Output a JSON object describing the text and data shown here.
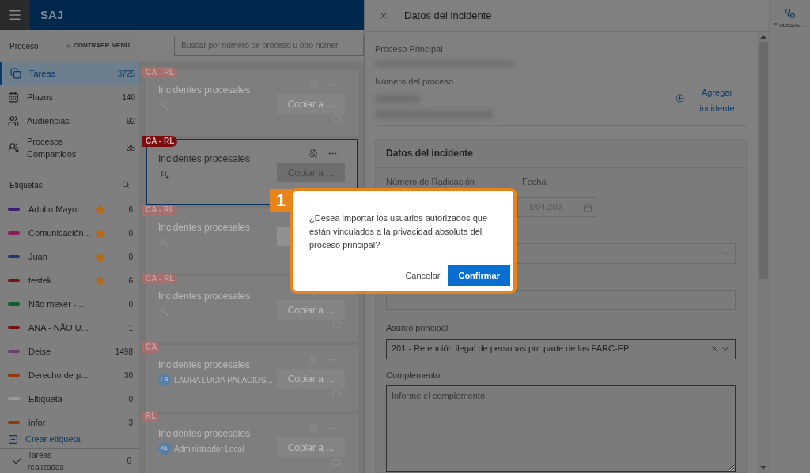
{
  "app": {
    "title": "SAJ"
  },
  "sidebar": {
    "heading": "Proceso",
    "collapse_label": "CONTRAER MENÚ",
    "nav": [
      {
        "kind": "tasks",
        "label": "Tareas",
        "count": "3725",
        "selected": true
      },
      {
        "kind": "deadlines",
        "label": "Plazos",
        "count": "140",
        "selected": false
      },
      {
        "kind": "hearings",
        "label": "Audiencias",
        "count": "92",
        "selected": false
      },
      {
        "kind": "shared",
        "label": "Procesos Compartidos",
        "count": "35",
        "selected": false
      }
    ],
    "labels_heading": "Etiquetas",
    "labels": [
      {
        "name": "Adulto Mayor",
        "count": "6",
        "favorite": true,
        "color": "#3b1f6e"
      },
      {
        "name": "Comunicación...",
        "count": "0",
        "favorite": true,
        "color": "#8a1f5e"
      },
      {
        "name": "Juan",
        "count": "0",
        "favorite": true,
        "color": "#1c3a70"
      },
      {
        "name": "testek",
        "count": "6",
        "favorite": true,
        "color": "#701414"
      },
      {
        "name": "Não mexer - ...",
        "count": "0",
        "favorite": false,
        "color": "#12602c"
      },
      {
        "name": "ANA - NÃO U...",
        "count": "1",
        "favorite": false,
        "color": "#6e1212"
      },
      {
        "name": "Deise",
        "count": "1498",
        "favorite": false,
        "color": "#6e3a70"
      },
      {
        "name": "Derecho de p...",
        "count": "30",
        "favorite": false,
        "color": "#8a3a0c"
      },
      {
        "name": "Eltiqueta",
        "count": "0",
        "favorite": false,
        "color": "#9a9a9a"
      },
      {
        "name": "infor",
        "count": "3",
        "favorite": false,
        "color": "#8a3a0c"
      }
    ],
    "create_label": "Crear etiqueta",
    "done": {
      "label": "Tareas realizadas",
      "count": "0"
    }
  },
  "search": {
    "placeholder": "Buscar por número de proceso u otro númer"
  },
  "cards": [
    {
      "tag": "CA - RL",
      "title": "Incidentes procesales",
      "action": "Copiar a ...",
      "selected": false
    },
    {
      "tag": "CA - RL",
      "title": "Incidentes procesales",
      "action": "Copiar a ...",
      "selected": true,
      "comment_icon": false
    },
    {
      "tag": "CA - RL",
      "title": "Incidentes procesales",
      "selected": false
    },
    {
      "tag": "CA - RL",
      "title": "Incidentes procesales",
      "action": "Copiar a ...",
      "selected": false
    },
    {
      "tag": "CA",
      "title": "Incidentes procesales",
      "action": "Copiar a ...",
      "selected": false,
      "assignee": {
        "initials": "LR",
        "name": "LAURA LUCIA PALACIOS..."
      }
    },
    {
      "tag": "RL",
      "title": "Incidentes procesales",
      "action": "Copiar a ...",
      "selected": false,
      "assignee": {
        "initials": "AL",
        "name": "Administrador Local"
      }
    }
  ],
  "panel": {
    "title": "Datos del incidente",
    "main_process_label": "Proceso Principal",
    "process_number_label": "Número del proceso",
    "add_link": "Agregar incidente",
    "section": {
      "title": "Datos del incidente",
      "number_label": "Número de Radicación",
      "date_label": "Fecha",
      "date_value": "1/04/202",
      "subject_label": "Asunto principal",
      "subject_value": "201 - Retención ilegal de personas por parte de las FARC-EP",
      "complement_label": "Complemento",
      "complement_placeholder": "Informe el complemento"
    }
  },
  "side_tool": {
    "label": "Procesos ..."
  },
  "dialog": {
    "step": "1",
    "message": "¿Desea importar los usuarios autorizados que están vinculados a la privacidad absoluta del proceso principal?",
    "buttons": [
      {
        "label": "Cancelar",
        "kind": "secondary"
      },
      {
        "label": "Confirmar",
        "kind": "primary"
      }
    ]
  }
}
